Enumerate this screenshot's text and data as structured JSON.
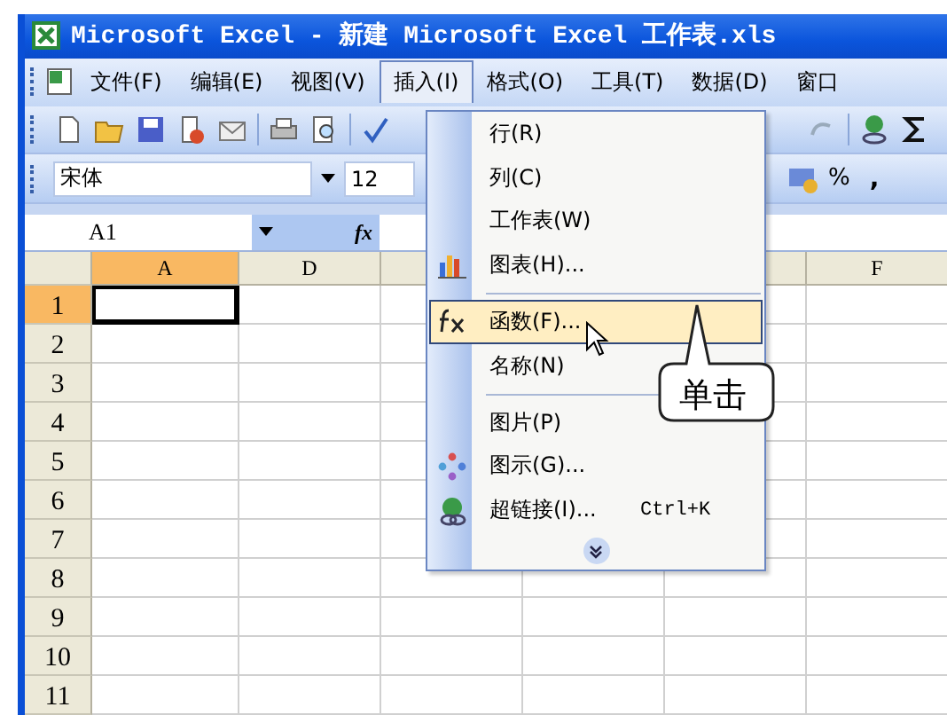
{
  "window": {
    "title": "Microsoft Excel - 新建 Microsoft Excel 工作表.xls"
  },
  "menu_bar": [
    {
      "label": "文件(F)",
      "selected": false
    },
    {
      "label": "编辑(E)",
      "selected": false
    },
    {
      "label": "视图(V)",
      "selected": false
    },
    {
      "label": "插入(I)",
      "selected": true
    },
    {
      "label": "格式(O)",
      "selected": false
    },
    {
      "label": "工具(T)",
      "selected": false
    },
    {
      "label": "数据(D)",
      "selected": false
    },
    {
      "label": "窗口",
      "selected": false
    }
  ],
  "formatting_toolbar": {
    "font": "宋体",
    "size": "12",
    "percent": "%",
    "comma": ","
  },
  "formula_bar": {
    "name_box": "A1",
    "fx": "fx"
  },
  "sheet": {
    "columns": [
      {
        "label": "A",
        "selected": true
      },
      {
        "label": "D",
        "selected": false
      },
      {
        "label": "F",
        "selected": false
      }
    ],
    "rows": [
      {
        "label": "1",
        "selected": true
      },
      {
        "label": "2",
        "selected": false
      },
      {
        "label": "3",
        "selected": false
      },
      {
        "label": "4",
        "selected": false
      },
      {
        "label": "5",
        "selected": false
      },
      {
        "label": "6",
        "selected": false
      },
      {
        "label": "7",
        "selected": false
      },
      {
        "label": "8",
        "selected": false
      },
      {
        "label": "9",
        "selected": false
      },
      {
        "label": "10",
        "selected": false
      },
      {
        "label": "11",
        "selected": false
      }
    ]
  },
  "insert_menu": {
    "items": [
      {
        "kind": "item",
        "label": "行(R)",
        "selected": false
      },
      {
        "kind": "item",
        "label": "列(C)",
        "selected": false
      },
      {
        "kind": "item",
        "label": "工作表(W)",
        "selected": false
      },
      {
        "kind": "item",
        "label": "图表(H)...",
        "selected": false
      },
      {
        "kind": "separator"
      },
      {
        "kind": "item",
        "label": "函数(F)...",
        "selected": true
      },
      {
        "kind": "item",
        "label": "名称(N)",
        "selected": false
      },
      {
        "kind": "separator"
      },
      {
        "kind": "item",
        "label": "图片(P)",
        "selected": false
      },
      {
        "kind": "item",
        "label": "图示(G)...",
        "selected": false
      },
      {
        "kind": "item",
        "label": "超链接(I)...",
        "shortcut": "Ctrl+K",
        "selected": false
      },
      {
        "kind": "expand"
      }
    ]
  },
  "callout": {
    "text": "单击"
  }
}
